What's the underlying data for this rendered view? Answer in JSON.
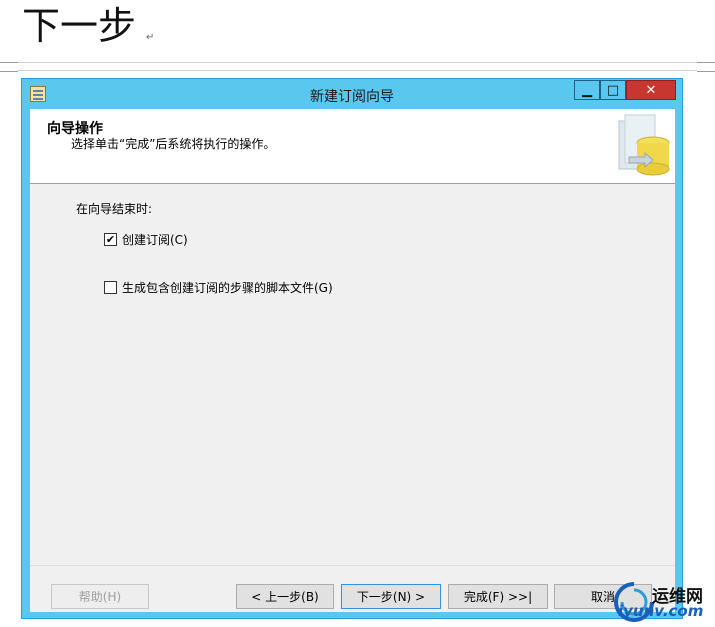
{
  "document": {
    "heading": "下一步",
    "paragraph_mark": "↵"
  },
  "window": {
    "title": "新建订阅向导",
    "controls": {
      "minimize": "▁",
      "maximize": "□",
      "close": "✕"
    },
    "header": {
      "title": "向导操作",
      "description": "选择单击“完成”后系统将执行的操作。"
    },
    "body": {
      "prompt": "在向导结束时:",
      "options": [
        {
          "label": "创建订阅(C)",
          "checked": true
        },
        {
          "label": "生成包含创建订阅的步骤的脚本文件(G)",
          "checked": false
        }
      ]
    },
    "buttons": {
      "help": "帮助(H)",
      "back": "< 上一步(B)",
      "next": "下一步(N) >",
      "finish": "完成(F) >>|",
      "cancel": "取消"
    }
  },
  "watermark": {
    "top": "运维网",
    "bottom": "iyunv.com"
  },
  "colors": {
    "title_bar": "#5ac7ef",
    "close_button": "#c7372f",
    "client_bg": "#f0f0f0"
  }
}
